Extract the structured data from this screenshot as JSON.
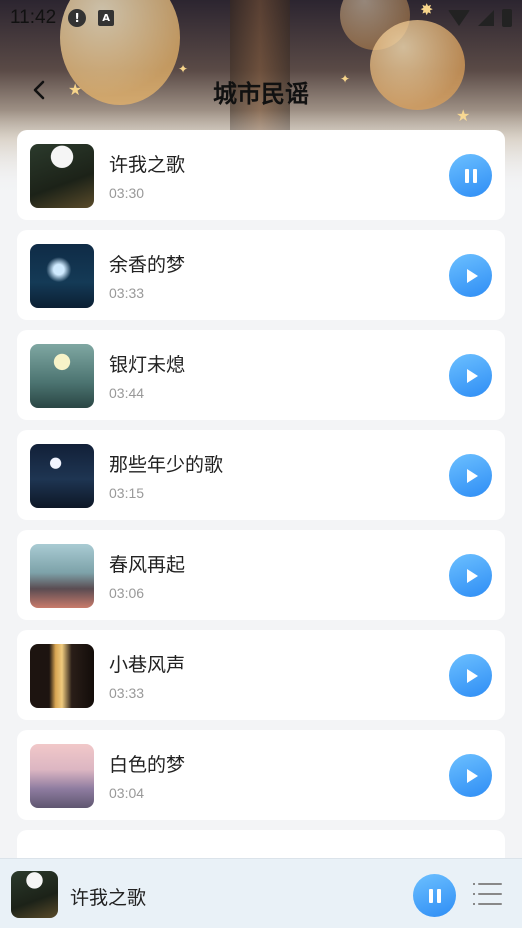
{
  "status_bar": {
    "time": "11:42",
    "icons": [
      "alert-icon",
      "font-icon",
      "wifi-icon",
      "signal-icon",
      "battery-icon"
    ]
  },
  "header": {
    "title": "城市民谣",
    "back_icon": "chevron-left-icon"
  },
  "songs": [
    {
      "title": "许我之歌",
      "duration": "03:30",
      "state": "playing"
    },
    {
      "title": "余香的梦",
      "duration": "03:33",
      "state": "paused"
    },
    {
      "title": "银灯未熄",
      "duration": "03:44",
      "state": "paused"
    },
    {
      "title": "那些年少的歌",
      "duration": "03:15",
      "state": "paused"
    },
    {
      "title": "春风再起",
      "duration": "03:06",
      "state": "paused"
    },
    {
      "title": "小巷风声",
      "duration": "03:33",
      "state": "paused"
    },
    {
      "title": "白色的梦",
      "duration": "03:04",
      "state": "paused"
    }
  ],
  "now_playing": {
    "title": "许我之歌",
    "state": "playing",
    "menu_icon": "playlist-icon"
  },
  "colors": {
    "accent": "#2e8df5",
    "accent_light": "#6cc0ff",
    "card": "#ffffff",
    "background": "#f3f4f6",
    "player_bar": "#e9f1f7"
  }
}
